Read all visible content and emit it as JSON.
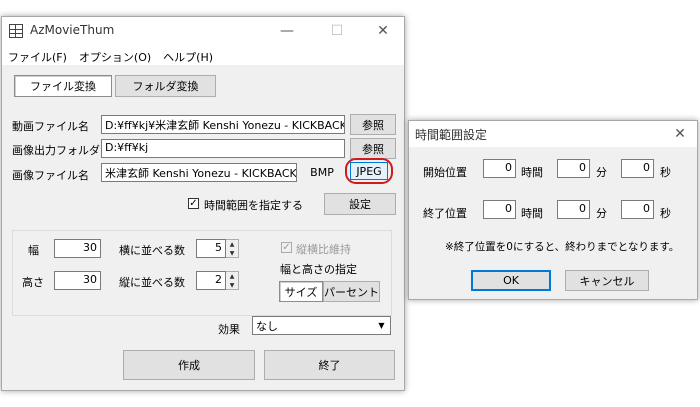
{
  "main": {
    "title": "AzMovieThum",
    "caption": {
      "minimize": "—",
      "maximize": "☐",
      "close": "✕"
    },
    "menu": [
      "ファイル(F)",
      "オプション(O)",
      "ヘルプ(H)"
    ],
    "tabs": {
      "file": "ファイル変換",
      "folder": "フォルダ変換"
    },
    "video_file": {
      "label": "動画ファイル名",
      "value": "D:¥ff¥kj¥米津玄師 Kenshi Yonezu - KICKBACK.m",
      "browse": "参照"
    },
    "output_folder": {
      "label": "画像出力フォルダ",
      "value": "D:¥ff¥kj",
      "browse": "参照"
    },
    "image_file": {
      "label": "画像ファイル名",
      "value": "米津玄師 Kenshi Yonezu - KICKBACK",
      "bmp": "BMP",
      "jpeg": "JPEG"
    },
    "time_range": {
      "checkbox_label": "時間範囲を指定する",
      "checked": true,
      "settings_button": "設定"
    },
    "size": {
      "width_label": "幅",
      "width_value": "30",
      "height_label": "高さ",
      "height_value": "30",
      "cols_label": "横に並べる数",
      "cols_value": "5",
      "rows_label": "縦に並べる数",
      "rows_value": "2",
      "keep_aspect_label": "縦横比維持",
      "keep_aspect_checked": true,
      "spec_label": "幅と高さの指定",
      "spec_size": "サイズ",
      "spec_percent": "パーセント"
    },
    "effect": {
      "label": "効果",
      "value": "なし"
    },
    "buttons": {
      "create": "作成",
      "exit": "終了"
    }
  },
  "dialog": {
    "title": "時間範囲設定",
    "close": "✕",
    "start": {
      "label": "開始位置",
      "h": "0",
      "h_unit": "時間",
      "m": "0",
      "m_unit": "分",
      "s": "0",
      "s_unit": "秒"
    },
    "end": {
      "label": "終了位置",
      "h": "0",
      "h_unit": "時間",
      "m": "0",
      "m_unit": "分",
      "s": "0",
      "s_unit": "秒"
    },
    "note": "※終了位置を0にすると、終わりまでとなります。",
    "ok": "OK",
    "cancel": "キャンセル"
  },
  "colors": {
    "highlight_ring": "#d11a1a",
    "focus_border": "#0078d7",
    "window_bg": "#f0f0f0"
  }
}
